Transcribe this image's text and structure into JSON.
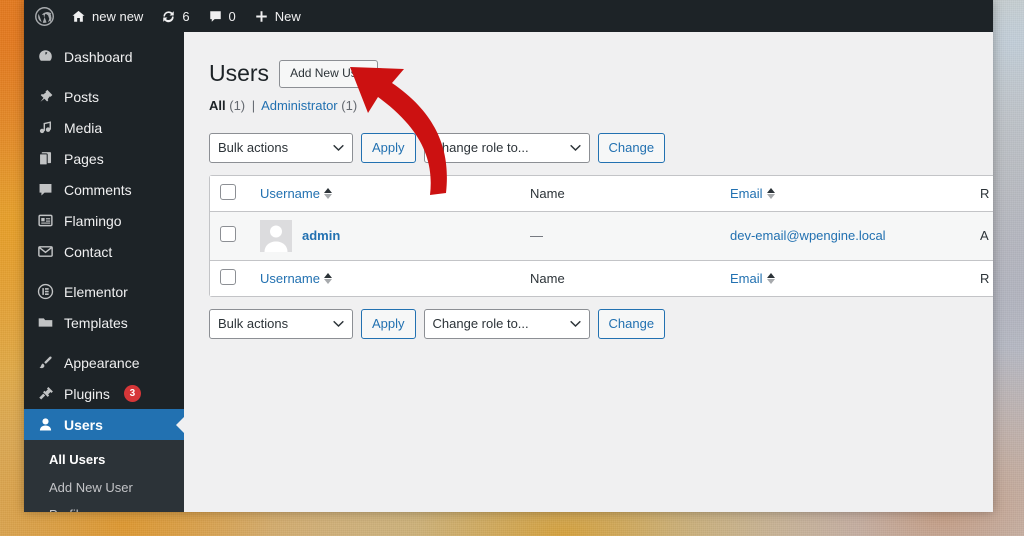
{
  "adminbar": {
    "wp_logo_icon": "wordpress-logo-icon",
    "site_icon": "home-icon",
    "site_name": "new new",
    "updates_icon": "updates-icon",
    "updates_count": "6",
    "comments_icon": "comment-bubble-icon",
    "comments_count": "0",
    "new_icon": "plus-icon",
    "new_label": "New"
  },
  "sidebar": {
    "items": [
      {
        "label": "Dashboard",
        "icon": "dashboard-icon",
        "current": false,
        "badge": ""
      },
      {
        "label": "Posts",
        "icon": "pin-icon",
        "current": false,
        "badge": ""
      },
      {
        "label": "Media",
        "icon": "media-icon",
        "current": false,
        "badge": ""
      },
      {
        "label": "Pages",
        "icon": "pages-icon",
        "current": false,
        "badge": ""
      },
      {
        "label": "Comments",
        "icon": "comment-bubble-icon",
        "current": false,
        "badge": ""
      },
      {
        "label": "Flamingo",
        "icon": "flamingo-icon",
        "current": false,
        "badge": ""
      },
      {
        "label": "Contact",
        "icon": "envelope-icon",
        "current": false,
        "badge": ""
      },
      {
        "label": "Elementor",
        "icon": "elementor-icon",
        "current": false,
        "badge": ""
      },
      {
        "label": "Templates",
        "icon": "folder-icon",
        "current": false,
        "badge": ""
      },
      {
        "label": "Appearance",
        "icon": "paintbrush-icon",
        "current": false,
        "badge": ""
      },
      {
        "label": "Plugins",
        "icon": "plug-icon",
        "current": false,
        "badge": "3"
      },
      {
        "label": "Users",
        "icon": "user-icon",
        "current": true,
        "badge": ""
      }
    ],
    "submenu": [
      {
        "label": "All Users",
        "current": true
      },
      {
        "label": "Add New User",
        "current": false
      },
      {
        "label": "Profile",
        "current": false
      }
    ]
  },
  "page": {
    "title": "Users",
    "add_new_label": "Add New User",
    "filters": {
      "all_label": "All",
      "all_count": "(1)",
      "separator": "|",
      "role_label": "Administrator",
      "role_count": "(1)"
    },
    "search": {
      "value": "",
      "placeholder": ""
    }
  },
  "tablenav": {
    "bulk_actions_label": "Bulk actions",
    "apply_label": "Apply",
    "change_role_label": "Change role to...",
    "change_label": "Change"
  },
  "table": {
    "columns": {
      "username": "Username",
      "name": "Name",
      "email": "Email",
      "role": "R"
    },
    "rows": [
      {
        "username": "admin",
        "name": "—",
        "email": "dev-email@wpengine.local",
        "role": "A",
        "avatar_icon": "default-avatar-icon"
      }
    ]
  },
  "annotation": {
    "arrow_icon": "curved-arrow-icon",
    "arrow_color": "#cc1111",
    "points_to": "Add New User"
  },
  "colors": {
    "admin_dark": "#1d2327",
    "submenu_dark": "#2c3338",
    "wp_blue": "#2271b1",
    "page_bg": "#f0f0f1",
    "badge_red": "#d63638",
    "arrow_red": "#cc1111"
  }
}
